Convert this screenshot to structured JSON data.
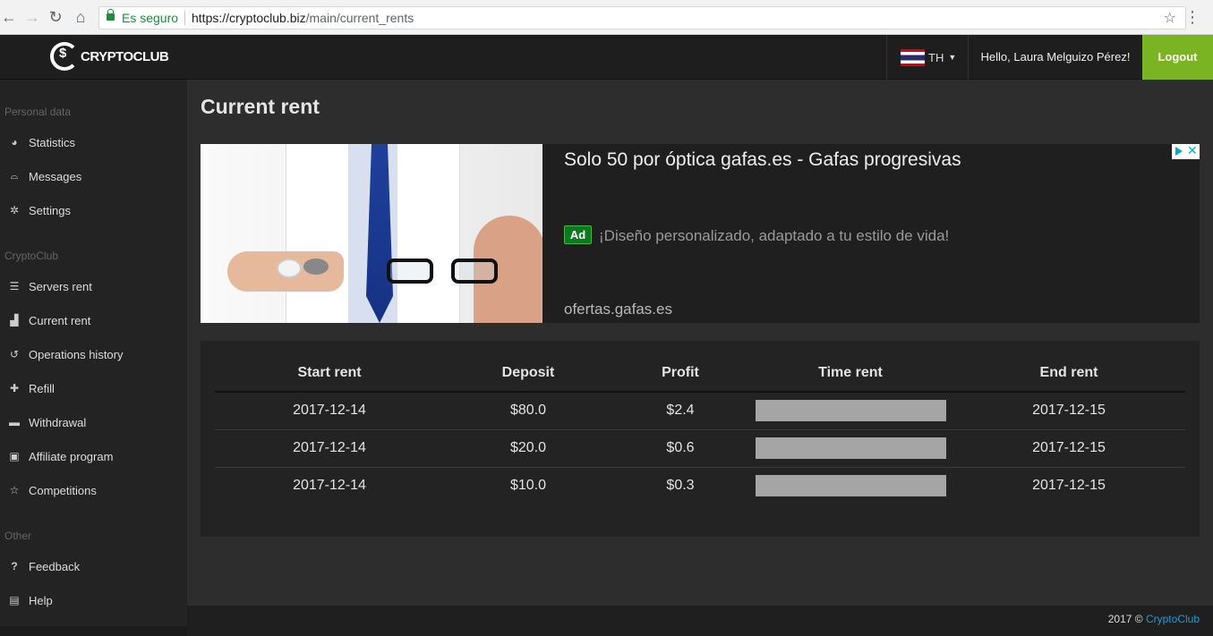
{
  "browser": {
    "secure_label": "Es seguro",
    "url_domain": "https://cryptoclub.biz",
    "url_path": "/main/current_rents"
  },
  "header": {
    "logo_text": "CRYPTOCLUB",
    "language": "TH",
    "greeting": "Hello, Laura Melguizo Pérez!",
    "logout_label": "Logout"
  },
  "sidebar": {
    "sections": [
      {
        "label": "Personal data"
      },
      {
        "label": "CryptoClub"
      },
      {
        "label": "Other"
      }
    ],
    "items": [
      {
        "label": "Statistics",
        "icon": "pie-chart-icon"
      },
      {
        "label": "Messages",
        "icon": "inbox-icon"
      },
      {
        "label": "Settings",
        "icon": "gear-icon"
      },
      {
        "label": "Servers rent",
        "icon": "server-icon"
      },
      {
        "label": "Current rent",
        "icon": "chart-icon"
      },
      {
        "label": "Operations history",
        "icon": "history-icon"
      },
      {
        "label": "Refill",
        "icon": "plus-icon"
      },
      {
        "label": "Withdrawal",
        "icon": "minus-icon"
      },
      {
        "label": "Affiliate program",
        "icon": "money-icon"
      },
      {
        "label": "Competitions",
        "icon": "star-icon"
      },
      {
        "label": "Feedback",
        "icon": "question-icon"
      },
      {
        "label": "Help",
        "icon": "book-icon"
      }
    ]
  },
  "main": {
    "title": "Current rent"
  },
  "ad": {
    "headline": "Solo 50 por óptica gafas.es - Gafas progresivas",
    "badge": "Ad",
    "description": "¡Diseño personalizado, adaptado a tu estilo de vida!",
    "domain": "ofertas.gafas.es"
  },
  "table": {
    "headers": [
      "Start rent",
      "Deposit",
      "Profit",
      "Time rent",
      "End rent"
    ],
    "rows": [
      {
        "start": "2017-12-14",
        "deposit": "$80.0",
        "profit": "$2.4",
        "end": "2017-12-15"
      },
      {
        "start": "2017-12-14",
        "deposit": "$20.0",
        "profit": "$0.6",
        "end": "2017-12-15"
      },
      {
        "start": "2017-12-14",
        "deposit": "$10.0",
        "profit": "$0.3",
        "end": "2017-12-15"
      }
    ]
  },
  "footer": {
    "copyright": "2017 ©",
    "link": "CryptoClub"
  },
  "colors": {
    "accent_green": "#7ab422",
    "link_blue": "#1e9bd7"
  }
}
